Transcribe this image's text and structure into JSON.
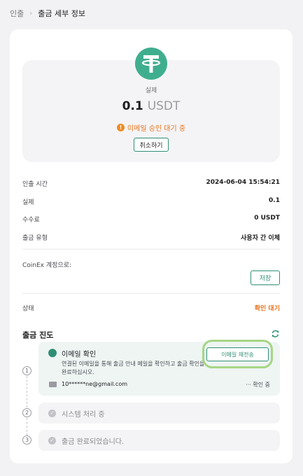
{
  "breadcrumb": {
    "parent": "인출",
    "current": "출금 세부 정보"
  },
  "summary": {
    "amount_caption": "실제",
    "amount_value": "0.1",
    "amount_unit": "USDT",
    "status_text": "이메일 승인 대기 중",
    "cancel_label": "취소하기"
  },
  "details": [
    {
      "label": "인출 시간",
      "value": "2024-06-04 15:54:21"
    },
    {
      "label": "실제",
      "value": "0.1"
    },
    {
      "label": "수수료",
      "value": "0 USDT"
    },
    {
      "label": "출금 유형",
      "value": "사용자 간 이체"
    }
  ],
  "account": {
    "label": "CoinEx 계정으로:",
    "save_label": "저장"
  },
  "status": {
    "label": "상태",
    "value": "확인 대기"
  },
  "progress": {
    "title": "출금 진도",
    "steps": [
      {
        "number": "1",
        "title": "이메일 확인",
        "description": "연결된 이메일을 통해 출금 안내 메일을 확인하고 출금 확인을 완료하십시오.",
        "email": "10******ne@gmail.com",
        "pending": "··· 확인 중",
        "resend_label": "이메일 재전송"
      },
      {
        "number": "2",
        "title": "시스템 처리 중"
      },
      {
        "number": "3",
        "title": "출금 완료되었습니다."
      }
    ]
  },
  "colors": {
    "accent": "#2f8f75",
    "warning": "#e8741d",
    "tether": "#3fae8f"
  }
}
